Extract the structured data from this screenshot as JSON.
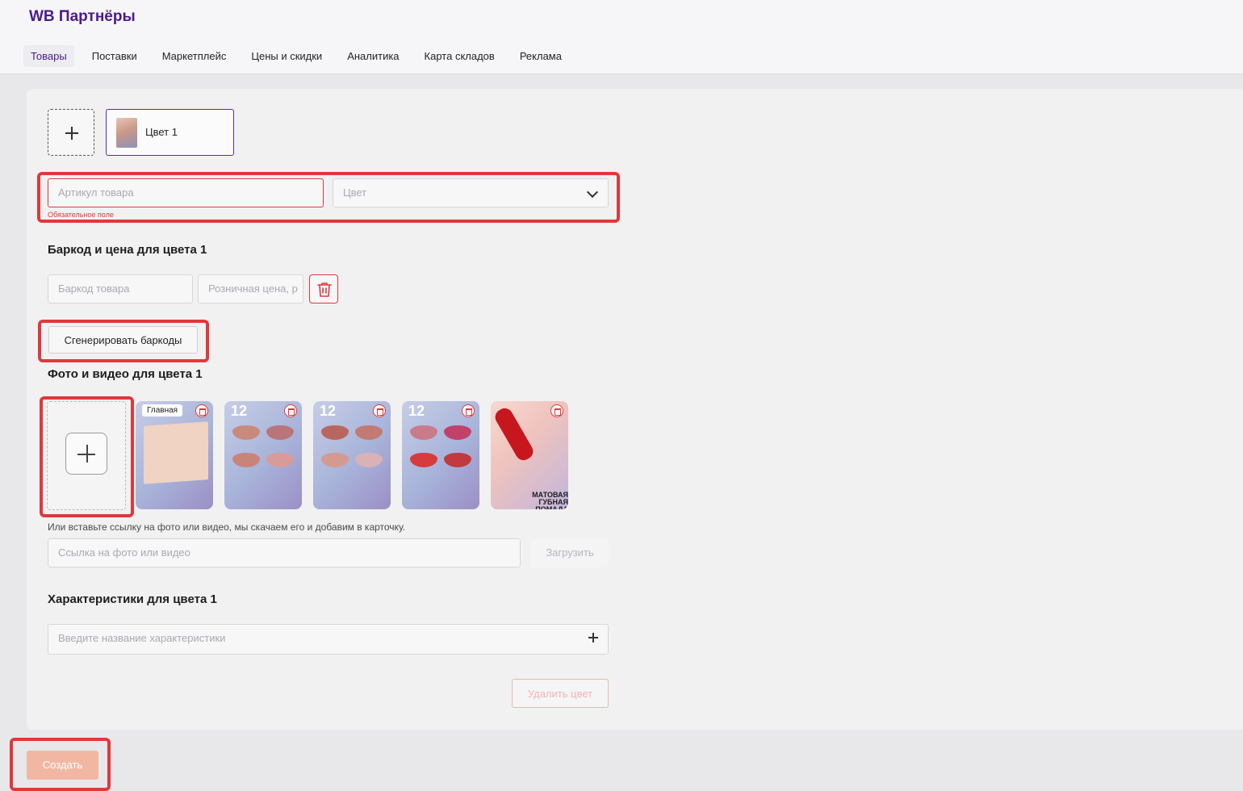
{
  "app": {
    "brand": "WB Партнёры"
  },
  "nav": {
    "items": [
      {
        "label": "Товары"
      },
      {
        "label": "Поставки"
      },
      {
        "label": "Маркетплейс"
      },
      {
        "label": "Цены и скидки"
      },
      {
        "label": "Аналитика"
      },
      {
        "label": "Карта складов"
      },
      {
        "label": "Реклама"
      }
    ],
    "active_index": 0
  },
  "colors_bar": {
    "tab_label": "Цвет 1"
  },
  "article": {
    "placeholder": "Артикул товара",
    "error": "Обязательное поле",
    "color_select_placeholder": "Цвет"
  },
  "barcode_section": {
    "title": "Баркод и цена для цвета 1",
    "barcode_placeholder": "Баркод товара",
    "price_placeholder": "Розничная цена, р",
    "generate_button": "Сгенерировать баркоды"
  },
  "media_section": {
    "title": "Фото и видео для цвета 1",
    "main_badge": "Главная",
    "thumb_big_label": "12",
    "last_thumb_caption": "МАТОВАЯ ГУБНАЯ ПОМАДА",
    "hint": "Или вставьте ссылку на фото или видео, мы скачаем его и добавим в карточку.",
    "link_placeholder": "Ссылка на фото или видео",
    "upload_button": "Загрузить"
  },
  "characteristics_section": {
    "title": "Характеристики для цвета 1",
    "search_placeholder": "Введите название характеристики"
  },
  "actions": {
    "delete_color": "Удалить цвет",
    "create": "Создать"
  },
  "theme": {
    "accent": "#4b1a8c",
    "error": "#e0383b",
    "create_button": "#f2b7a2"
  }
}
